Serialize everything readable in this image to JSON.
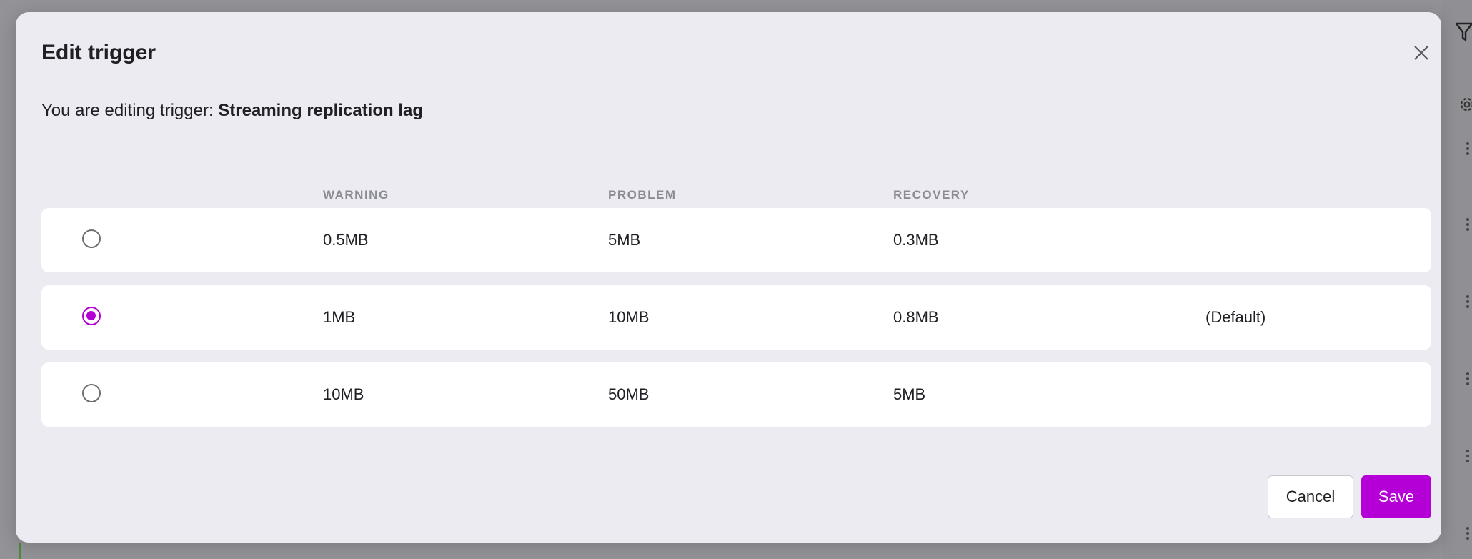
{
  "dialog": {
    "title": "Edit trigger",
    "subtitle_prefix": "You are editing trigger: ",
    "trigger_name": "Streaming replication lag",
    "columns": {
      "warning": "WARNING",
      "problem": "PROBLEM",
      "recovery": "RECOVERY"
    },
    "options": [
      {
        "warning": "0.5MB",
        "problem": "5MB",
        "recovery": "0.3MB",
        "note": "",
        "selected": false
      },
      {
        "warning": "1MB",
        "problem": "10MB",
        "recovery": "0.8MB",
        "note": "(Default)",
        "selected": true
      },
      {
        "warning": "10MB",
        "problem": "50MB",
        "recovery": "5MB",
        "note": "",
        "selected": false
      }
    ],
    "cancel_label": "Cancel",
    "save_label": "Save"
  },
  "colors": {
    "accent": "#b400d6",
    "dialog_bg": "#ecebf2",
    "overlay": "#939397"
  },
  "icons": {
    "close": "close-icon",
    "filter": "filter-icon",
    "gear": "gear-icon",
    "more": "more-vertical-icon"
  }
}
